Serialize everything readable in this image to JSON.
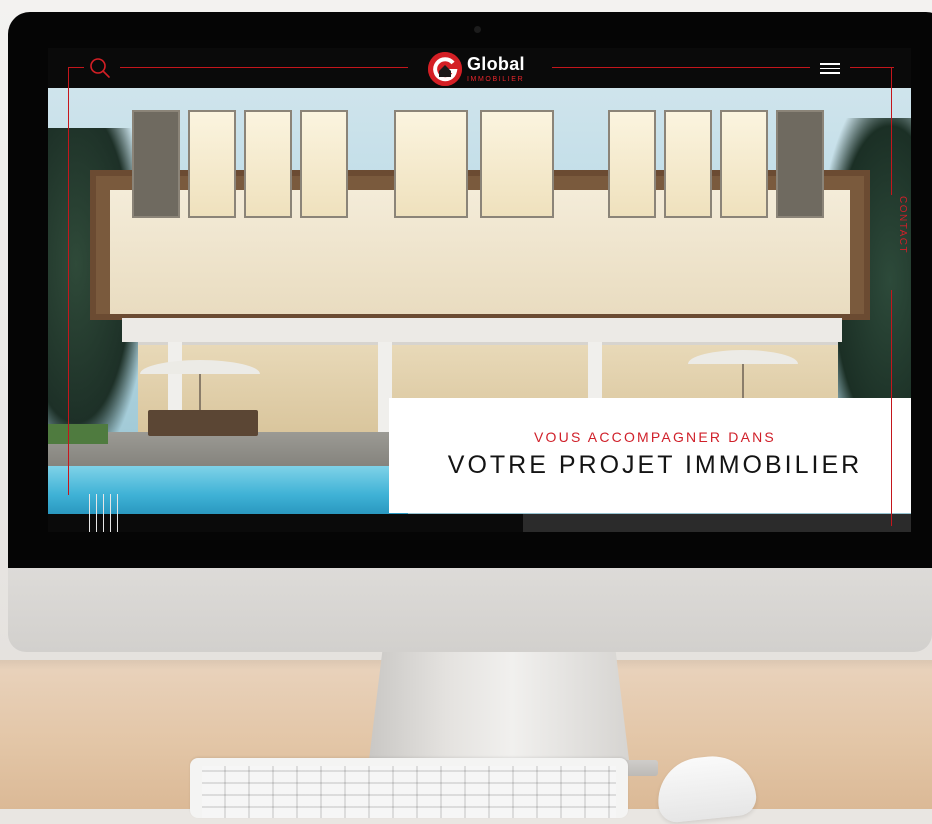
{
  "site": {
    "logo": {
      "icon": "g-house-logo-icon",
      "name": "Global",
      "tagline": "IMMOBILIER"
    },
    "navbar": {
      "search_icon": "search-icon",
      "menu_icon": "hamburger-menu-icon"
    },
    "hero": {
      "subtitle": "VOUS ACCOMPAGNER DANS",
      "title": "VOTRE PROJET IMMOBILIER"
    },
    "side_link": "CONTACT"
  },
  "colors": {
    "accent_red": "#c4161c",
    "navbar_bg": "#0a0a0a",
    "card_bg": "#ffffff",
    "title_text": "#141414"
  }
}
